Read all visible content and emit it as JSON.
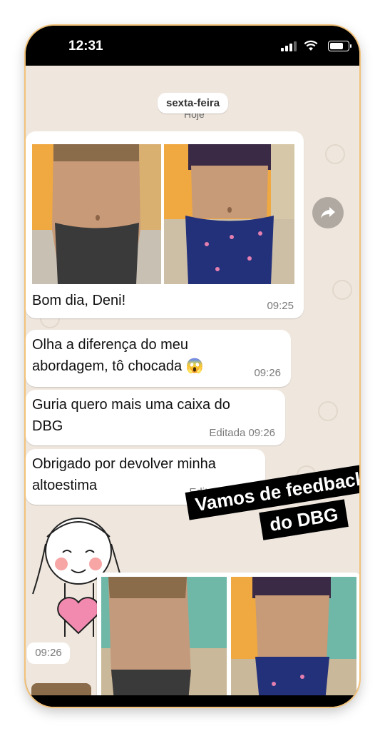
{
  "status_bar": {
    "time": "12:31"
  },
  "chat": {
    "date_label": "sexta-feira",
    "date_sub_label": "Hoje",
    "messages": [
      {
        "text": "Bom dia, Deni!",
        "time": "09:25"
      },
      {
        "line1": "Olha a diferença do meu",
        "line2": "abordagem, tô chocada",
        "emoji": "😱",
        "time": "09:26"
      },
      {
        "line1": "Guria quero mais uma caixa do",
        "line2": "DBG",
        "time": "Editada 09:26"
      },
      {
        "line1": "Obrigado por devolver minha",
        "line2": "altoestima",
        "time": "Editada 09:26"
      }
    ],
    "bottom_photo_time": "09:26"
  },
  "banner": {
    "line1": "Vamos de feedback",
    "line2": "do DBG"
  },
  "icons": {
    "forward": "forward-arrow-icon",
    "signal": "cellular-signal-icon",
    "wifi": "wifi-icon",
    "battery": "battery-icon"
  }
}
